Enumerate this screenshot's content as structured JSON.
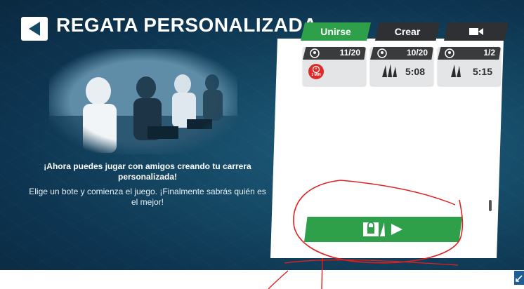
{
  "header": {
    "title": "REGATA PERSONALIZADA"
  },
  "description": {
    "bold_text": "¡Ahora puedes jugar con amigos creando tu carrera personalizada!",
    "normal_text": "Elige un bote y comienza el juego. ¡Finalmente sabrás quién es el mejor!"
  },
  "tabs": [
    {
      "label": "Unirse",
      "active": true
    },
    {
      "label": "Crear",
      "active": false
    },
    {
      "icon": "video-camera-icon",
      "active": false
    }
  ],
  "races": [
    {
      "players": "11/20",
      "timer_label": "1 MIN",
      "time": ""
    },
    {
      "players": "10/20",
      "time": "5:08"
    },
    {
      "players": "1/2",
      "time": "5:15"
    }
  ],
  "play_button": {
    "icons": [
      "lock-boat-icon",
      "play-icon"
    ]
  },
  "colors": {
    "accent_green": "#2ea04a",
    "tab_dark": "#2f3033",
    "background": "#154a66",
    "annotation_red": "#e02020"
  }
}
